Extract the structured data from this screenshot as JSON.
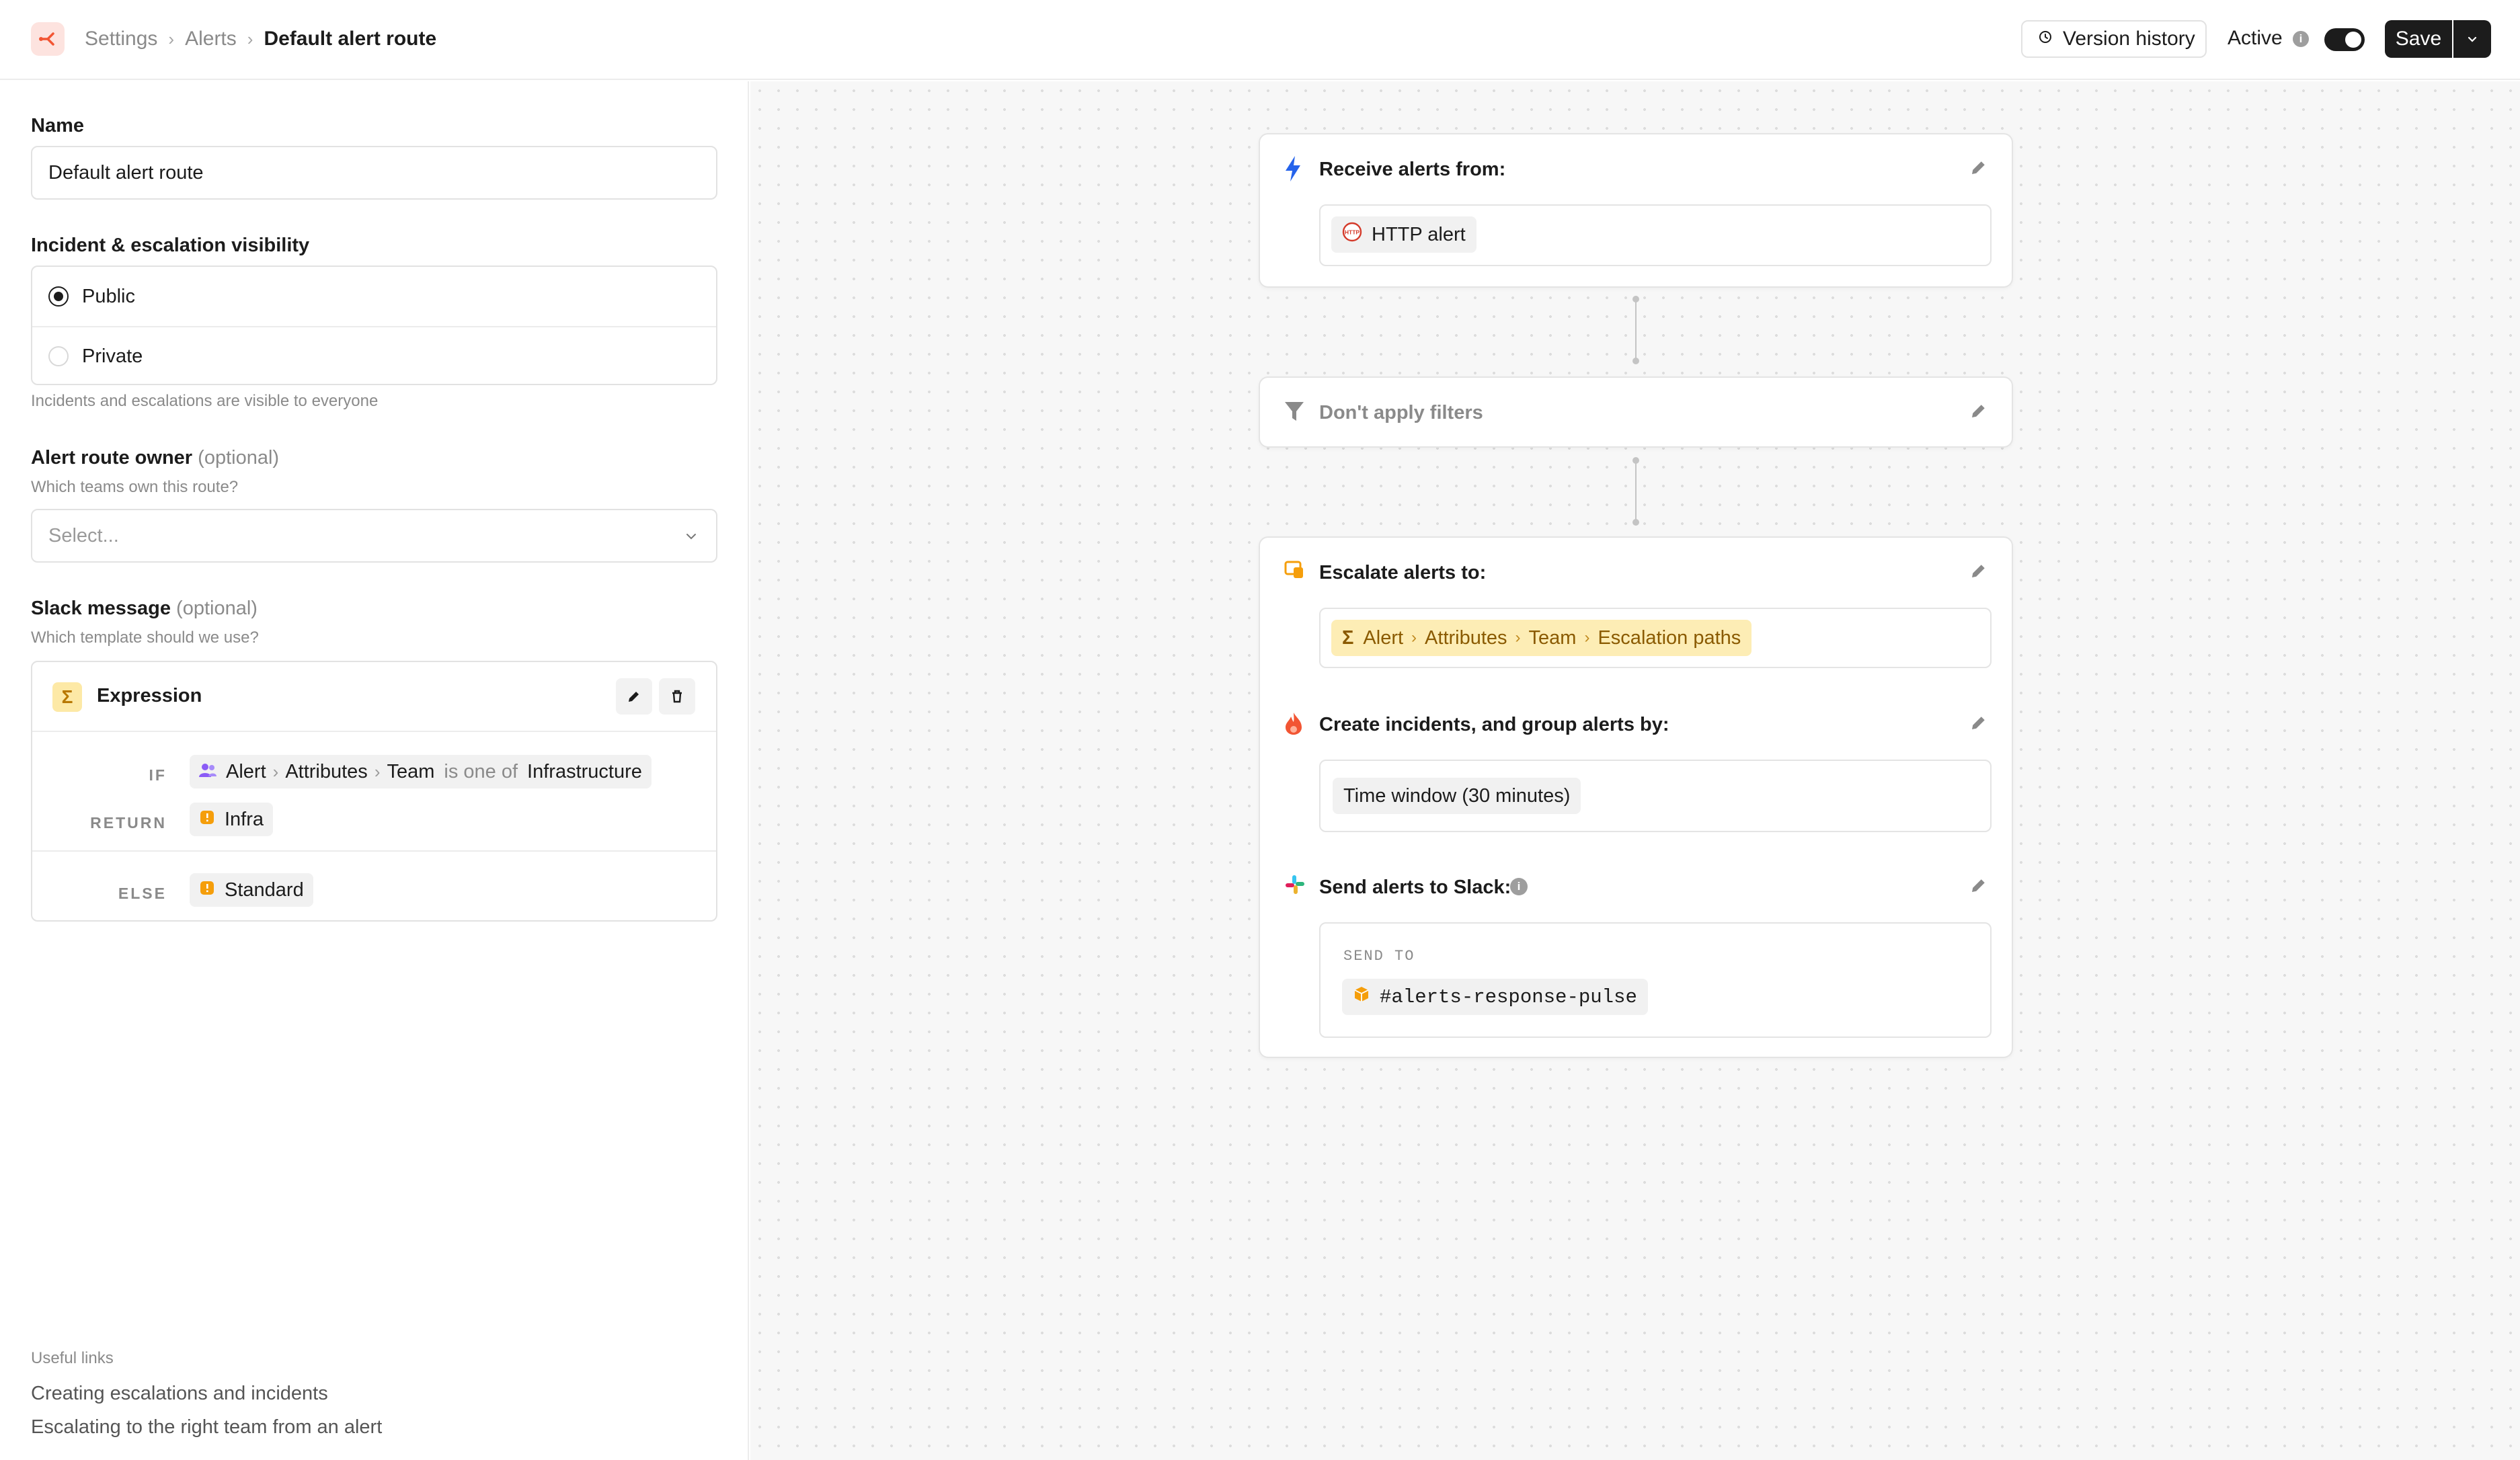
{
  "breadcrumb": {
    "items": [
      "Settings",
      "Alerts"
    ],
    "current": "Default alert route"
  },
  "header": {
    "version_history": "Version history",
    "active_label": "Active",
    "active_on": true,
    "save_label": "Save"
  },
  "form": {
    "name": {
      "label": "Name",
      "value": "Default alert route"
    },
    "visibility": {
      "label": "Incident & escalation visibility",
      "options": [
        {
          "label": "Public",
          "selected": true
        },
        {
          "label": "Private",
          "selected": false
        }
      ],
      "help": "Incidents and escalations are visible to everyone"
    },
    "owner": {
      "label": "Alert route owner",
      "optional": "(optional)",
      "help": "Which teams own this route?",
      "placeholder": "Select..."
    },
    "slack_message": {
      "label": "Slack message",
      "optional": "(optional)",
      "help": "Which template should we use?",
      "expression": {
        "title": "Expression",
        "if_kw": "IF",
        "return_kw": "RETURN",
        "else_kw": "ELSE",
        "condition": {
          "path": [
            "Alert",
            "Attributes",
            "Team"
          ],
          "operator": "is one of",
          "value": "Infrastructure"
        },
        "return_value": "Infra",
        "else_value": "Standard"
      }
    }
  },
  "useful_links": {
    "title": "Useful links",
    "links": [
      "Creating escalations and incidents",
      "Escalating to the right team from an alert"
    ]
  },
  "flow": {
    "receive": {
      "title": "Receive alerts from:",
      "source": "HTTP alert"
    },
    "filters": {
      "title": "Don't apply filters"
    },
    "escalate": {
      "title": "Escalate alerts to:",
      "path": [
        "Alert",
        "Attributes",
        "Team",
        "Escalation paths"
      ]
    },
    "incidents": {
      "title": "Create incidents, and group alerts by:",
      "grouping": "Time window (30 minutes)"
    },
    "slack": {
      "title": "Send alerts to Slack:",
      "send_to_label": "SEND TO",
      "channel": "#alerts-response-pulse"
    }
  },
  "colors": {
    "accent": "#1c1c1c",
    "brand": "#f25533",
    "expression_yellow": "#fdedb5",
    "canvas_bg": "#f7f7f7"
  }
}
